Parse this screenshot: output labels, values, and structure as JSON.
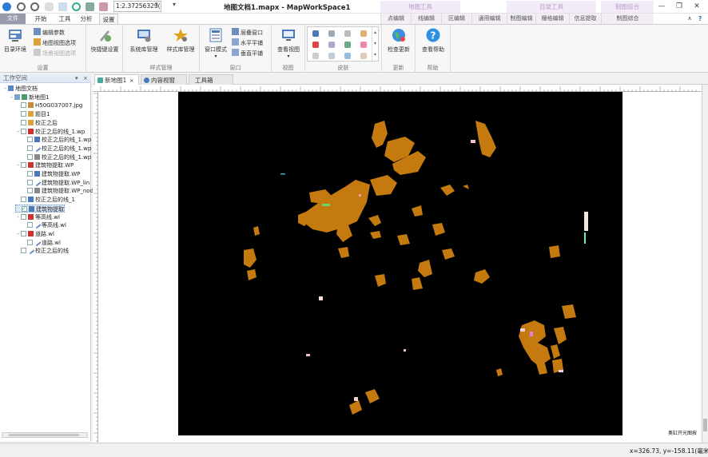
{
  "app": {
    "doc_title": "地图文档1.mapx - MapWorkSpace1",
    "scale_value": "1:2.37256329(",
    "context_tabs": [
      "地图工具",
      "目录工具",
      "制图综合"
    ]
  },
  "ribbon_tabs": {
    "file": "文件",
    "tabs": [
      "开始",
      "工具",
      "分析",
      "设置"
    ],
    "active": "设置",
    "context": [
      "点编辑",
      "线编辑",
      "区编辑",
      "通用编辑",
      "制图编辑",
      "栅格编辑",
      "信息提取",
      "制图综合"
    ]
  },
  "ribbon": {
    "settings_group": {
      "big": "目录环境",
      "items": [
        "编辑参数",
        "地图视图选项",
        "场景视图选项"
      ],
      "label": "设置"
    },
    "quick": {
      "big": "快捷键设置"
    },
    "style_group": {
      "items": [
        "系统库管理",
        "样式库管理"
      ],
      "label": "样式管理"
    },
    "window_group": {
      "big": "窗口模式",
      "items": [
        "层叠窗口",
        "水平平铺",
        "垂直平铺"
      ],
      "label": "窗口"
    },
    "view_group": {
      "big": "查看视图",
      "label": "视图"
    },
    "skin_group": {
      "label": "皮肤"
    },
    "update_group": {
      "big": "检查更新",
      "label": "更新"
    },
    "help_group": {
      "big": "查看帮助",
      "label": "帮助"
    }
  },
  "workspace": {
    "title": "工作空间",
    "controls": [
      "▾",
      "×"
    ],
    "tree": [
      {
        "label": "地图文档",
        "level": 0,
        "exp": "-",
        "check": "none",
        "icon": "map-doc"
      },
      {
        "label": "新地图1",
        "level": 1,
        "exp": "-",
        "check": "partial",
        "icon": "map"
      },
      {
        "label": "H50G037007.jpg",
        "level": 2,
        "exp": "",
        "check": "off",
        "icon": "raster"
      },
      {
        "label": "题目1",
        "level": 2,
        "exp": "",
        "check": "off",
        "icon": "layer"
      },
      {
        "label": "校正之后",
        "level": 2,
        "exp": "",
        "check": "off",
        "icon": "layer"
      },
      {
        "label": "校正之后的线_1.wp",
        "level": 2,
        "exp": "-",
        "check": "off",
        "icon": "group"
      },
      {
        "label": "校正之后的线_1.wp",
        "level": 3,
        "exp": "",
        "check": "off",
        "icon": "polygon"
      },
      {
        "label": "校正之后的线_1.wp",
        "level": 3,
        "exp": "",
        "check": "off",
        "icon": "line"
      },
      {
        "label": "校正之后的线_1.wp",
        "level": 3,
        "exp": "",
        "check": "off",
        "icon": "point"
      },
      {
        "label": "建筑物提取.WP",
        "level": 2,
        "exp": "-",
        "check": "off",
        "icon": "group"
      },
      {
        "label": "建筑物提取.WP",
        "level": 3,
        "exp": "",
        "check": "off",
        "icon": "polygon"
      },
      {
        "label": "建筑物提取.WP_lin",
        "level": 3,
        "exp": "",
        "check": "off",
        "icon": "line"
      },
      {
        "label": "建筑物提取.WP_nod",
        "level": 3,
        "exp": "",
        "check": "off",
        "icon": "point"
      },
      {
        "label": "校正之后的线_1",
        "level": 2,
        "exp": "",
        "check": "off",
        "icon": "polygon"
      },
      {
        "label": "建筑物提取",
        "level": 2,
        "exp": "",
        "check": "on",
        "icon": "polygon",
        "selected": true
      },
      {
        "label": "等高线.wl",
        "level": 2,
        "exp": "-",
        "check": "off",
        "icon": "group"
      },
      {
        "label": "等高线.wl",
        "level": 3,
        "exp": "",
        "check": "off",
        "icon": "line"
      },
      {
        "label": "道路.wl",
        "level": 2,
        "exp": "-",
        "check": "off",
        "icon": "group"
      },
      {
        "label": "道路.wl",
        "level": 3,
        "exp": "",
        "check": "off",
        "icon": "line"
      },
      {
        "label": "校正之后的线",
        "level": 2,
        "exp": "",
        "check": "off",
        "icon": "line"
      }
    ]
  },
  "doc_tabs": [
    "新地图1",
    "内容视窗",
    "工具箱"
  ],
  "map": {
    "background": "#000000",
    "polygon_color": "#c47a0e",
    "caption": "奥缸开光图按"
  },
  "status": {
    "coords": "x=326.73, y=-158.11(毫米)"
  },
  "colors": {
    "accent": "#2b579a",
    "selection": "#dce9f8"
  }
}
